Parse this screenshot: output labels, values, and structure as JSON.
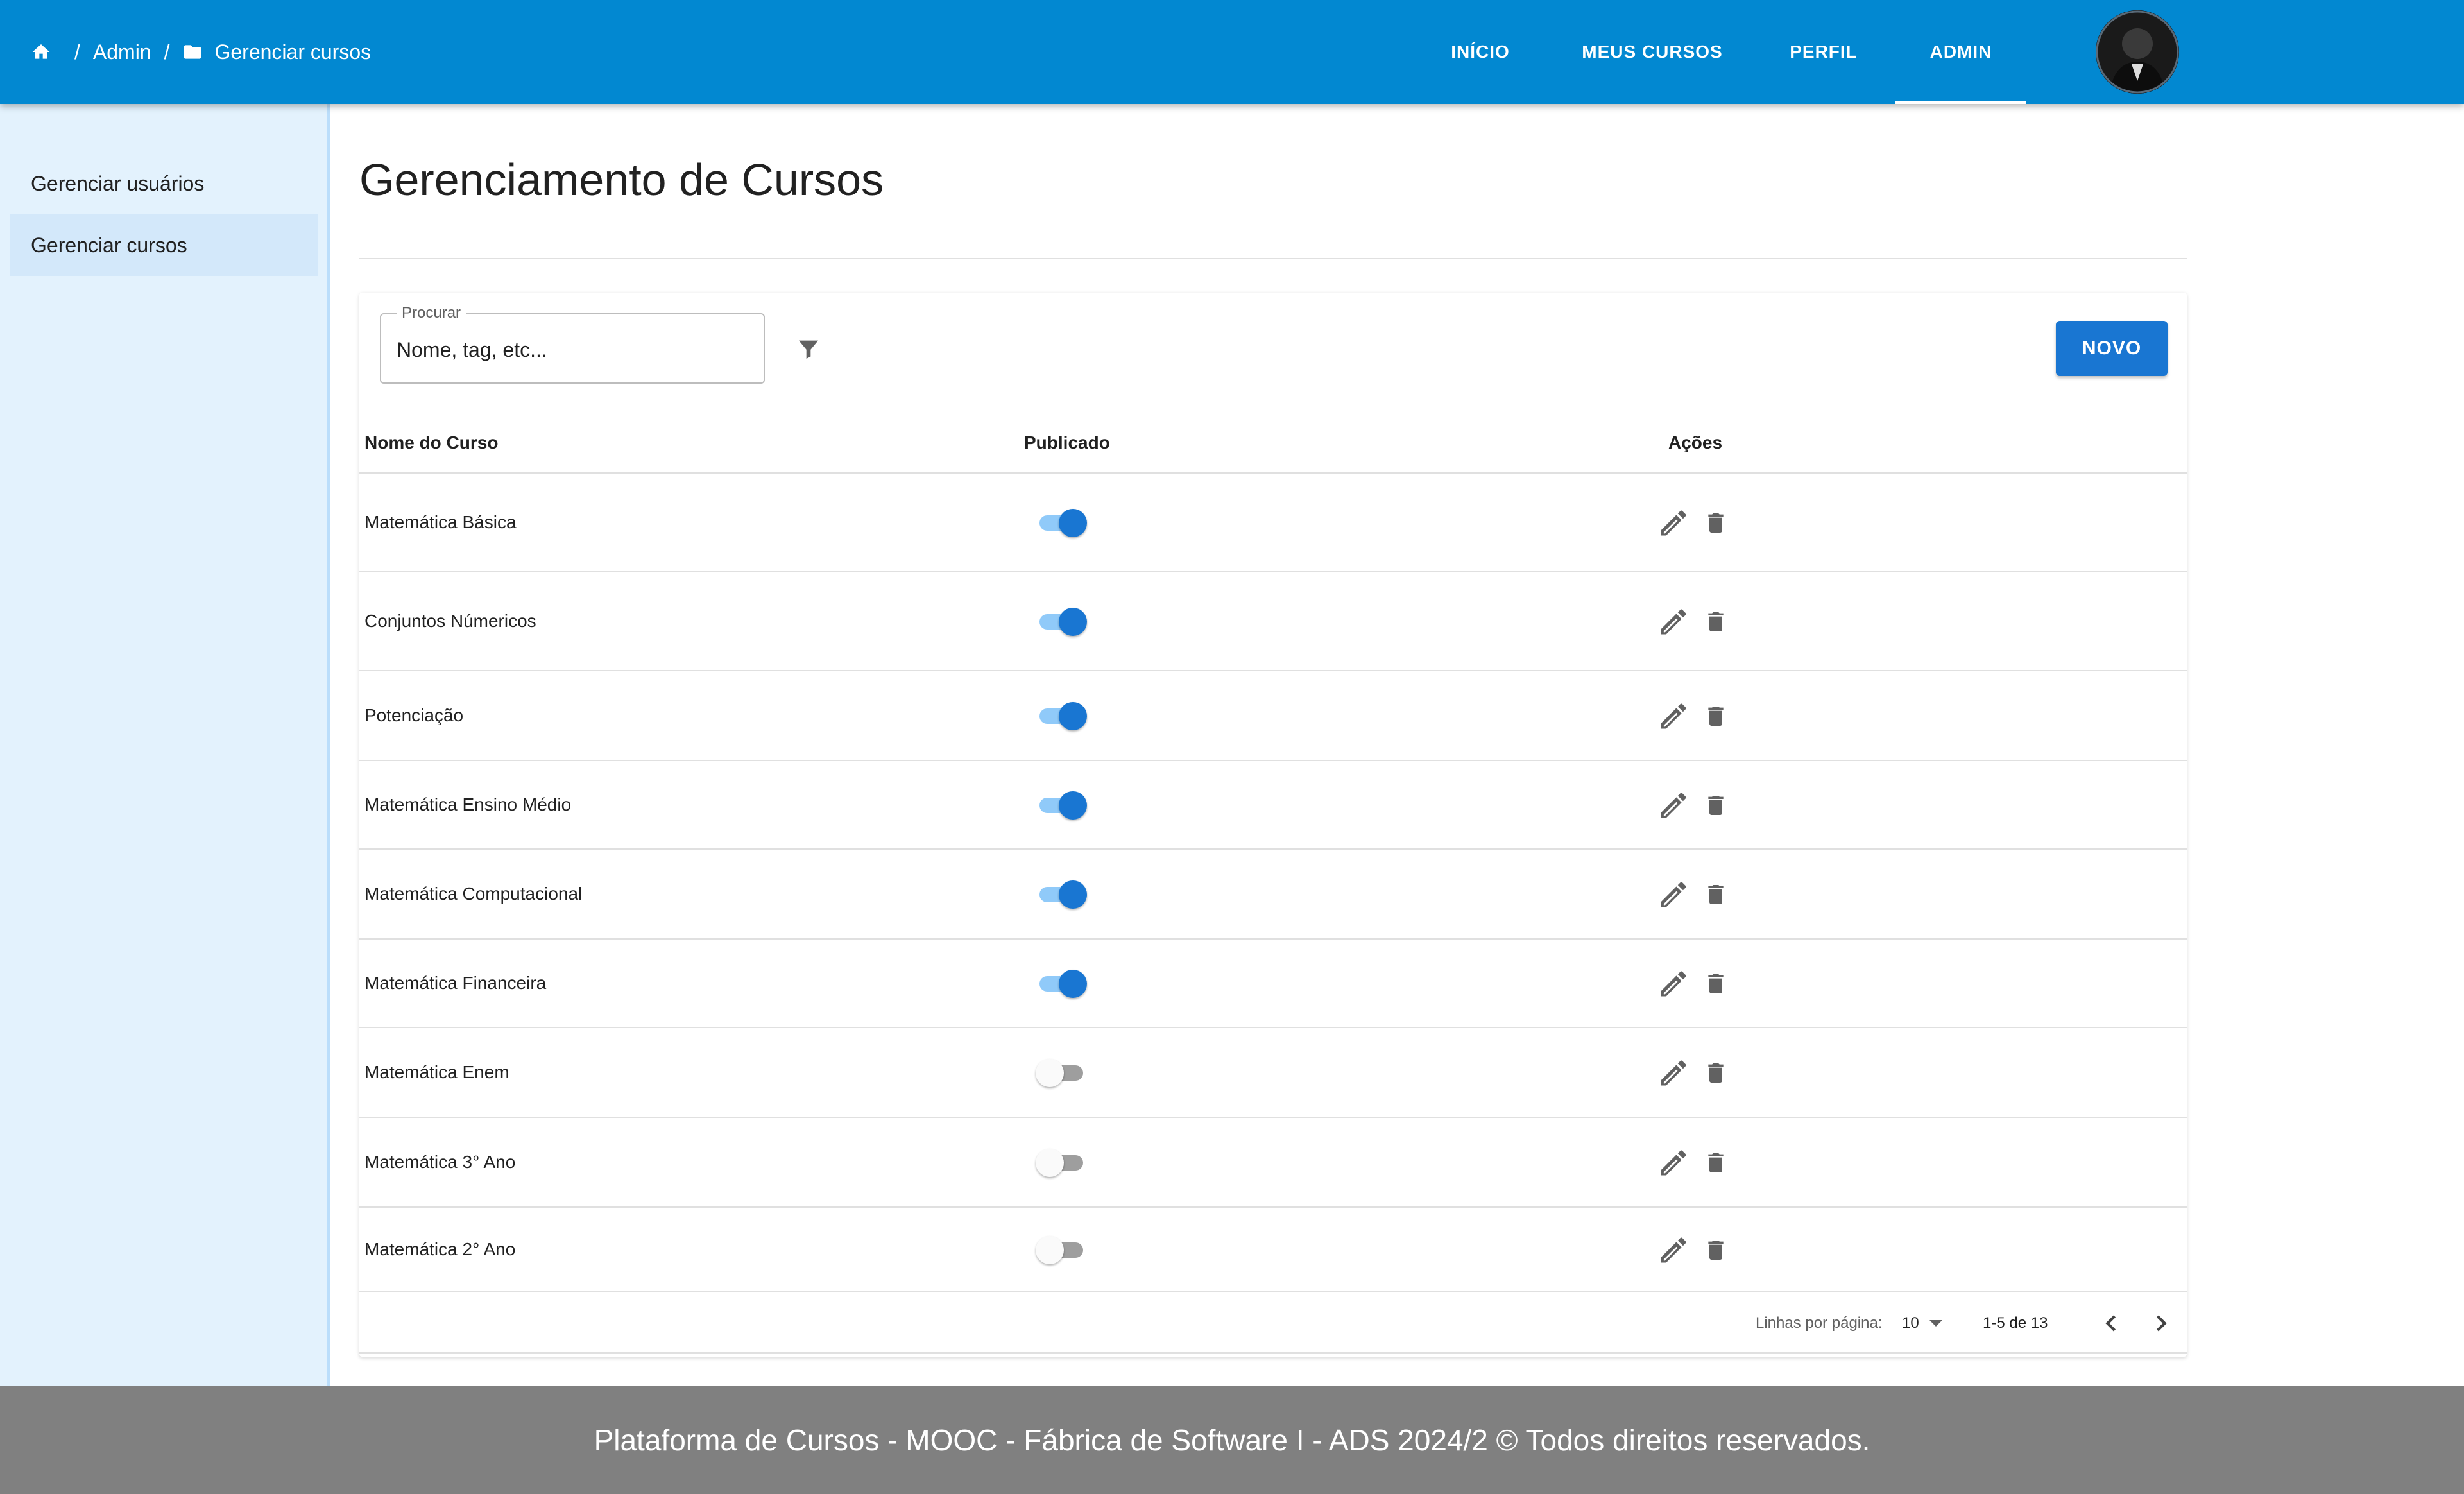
{
  "breadcrumb": {
    "admin": "Admin",
    "current": "Gerenciar cursos",
    "sep": "/"
  },
  "nav": [
    {
      "label": "INÍCIO"
    },
    {
      "label": "MEUS CURSOS"
    },
    {
      "label": "PERFIL"
    },
    {
      "label": "ADMIN",
      "active": true
    }
  ],
  "sidebar": {
    "items": [
      {
        "label": "Gerenciar usuários",
        "selected": false
      },
      {
        "label": "Gerenciar cursos",
        "selected": true
      }
    ]
  },
  "page": {
    "title": "Gerenciamento de Cursos"
  },
  "search": {
    "label": "Procurar",
    "placeholder": "Nome, tag, etc..."
  },
  "toolbar": {
    "new_label": "NOVO"
  },
  "table": {
    "headers": {
      "name": "Nome do Curso",
      "published": "Publicado",
      "actions": "Ações"
    },
    "rows": [
      {
        "name": "Matemática Básica",
        "published": true
      },
      {
        "name": "Conjuntos Númericos",
        "published": true
      },
      {
        "name": "Potenciação",
        "published": true
      },
      {
        "name": "Matemática Ensino Médio",
        "published": true
      },
      {
        "name": "Matemática Computacional",
        "published": true
      },
      {
        "name": "Matemática Financeira",
        "published": true
      },
      {
        "name": "Matemática Enem",
        "published": false
      },
      {
        "name": "Matemática 3° Ano",
        "published": false
      },
      {
        "name": "Matemática 2° Ano",
        "published": false
      }
    ]
  },
  "pagination": {
    "rows_label": "Linhas por página:",
    "rows_value": "10",
    "range": "1-5 de 13"
  },
  "footer": {
    "text": "Plataforma de Cursos - MOOC - Fábrica de Software I - ADS 2024/2  ©  Todos direitos reservados."
  },
  "colors": {
    "appbar": "#0288d1",
    "accent": "#1976d2",
    "sidebar": "#e3f2fd",
    "footer": "#808080"
  },
  "icons": {
    "home": "home-icon",
    "folder": "folder-icon",
    "filter": "filter-icon",
    "edit": "pencil-icon",
    "delete": "trash-icon",
    "prev": "chevron-left-icon",
    "next": "chevron-right-icon"
  }
}
